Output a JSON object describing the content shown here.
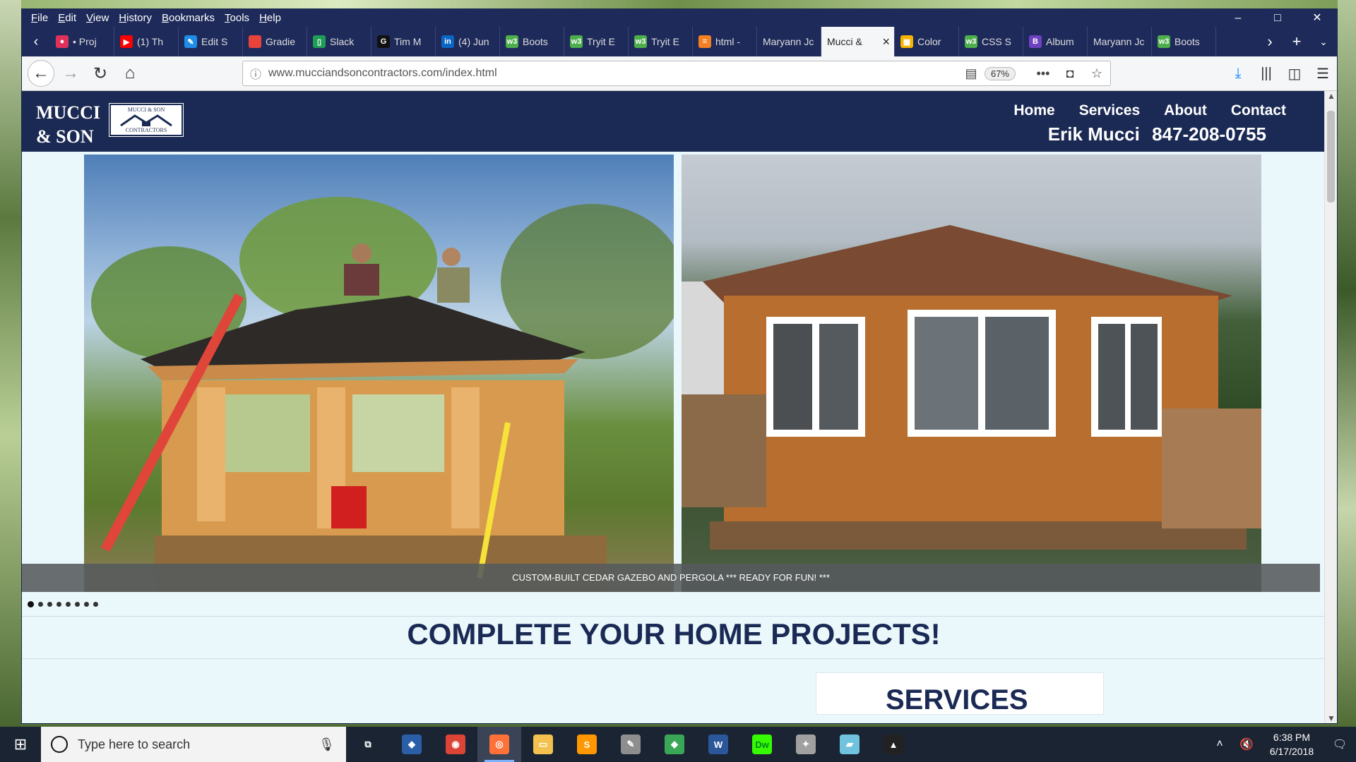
{
  "menu": [
    "File",
    "Edit",
    "View",
    "History",
    "Bookmarks",
    "Tools",
    "Help"
  ],
  "window_controls": {
    "minimize": "–",
    "maximize": "□",
    "close": "✕"
  },
  "tabs": [
    {
      "label": "• Proj",
      "color": "#e0315b",
      "glyph": "●"
    },
    {
      "label": "(1) Th",
      "color": "#ff0000",
      "glyph": "▶"
    },
    {
      "label": "Edit S",
      "color": "#1f8ce8",
      "glyph": "✎"
    },
    {
      "label": "Gradie",
      "color": "#e8433a",
      "glyph": ""
    },
    {
      "label": "Slack",
      "color": "#1f9d55",
      "glyph": "▯"
    },
    {
      "label": "Tim M",
      "color": "#111111",
      "glyph": "G"
    },
    {
      "label": "(4) Jun",
      "color": "#0a66c2",
      "glyph": "in"
    },
    {
      "label": "Boots",
      "color": "#4cae4c",
      "glyph": "w3"
    },
    {
      "label": "Tryit E",
      "color": "#4cae4c",
      "glyph": "w3"
    },
    {
      "label": "Tryit E",
      "color": "#4cae4c",
      "glyph": "w3"
    },
    {
      "label": "html -",
      "color": "#f48024",
      "glyph": "≡"
    },
    {
      "label": "Maryann Jc",
      "color": "",
      "glyph": ""
    },
    {
      "label": "Mucci &",
      "color": "",
      "glyph": "",
      "active": true
    },
    {
      "label": "Color",
      "color": "#f4b400",
      "glyph": "▦"
    },
    {
      "label": "CSS S",
      "color": "#4cae4c",
      "glyph": "w3"
    },
    {
      "label": "Album",
      "color": "#6f42c1",
      "glyph": "B"
    },
    {
      "label": "Maryann Jc",
      "color": "",
      "glyph": ""
    },
    {
      "label": "Boots",
      "color": "#4cae4c",
      "glyph": "w3"
    }
  ],
  "address": {
    "url": "www.mucciandsoncontractors.com/index.html",
    "zoom": "67%"
  },
  "site": {
    "logo_line1": "MUCCI",
    "logo_line2": "& SON",
    "logo_badge_top": "MUCCI & SON",
    "logo_badge_bottom": "CONTRACTORS",
    "nav": [
      "Home",
      "Services",
      "About",
      "Contact"
    ],
    "contact_name": "Erik Mucci",
    "contact_phone": "847-208-0755"
  },
  "carousel": {
    "caption": "CUSTOM-BUILT CEDAR GAZEBO AND PERGOLA *** READY FOR FUN! ***",
    "slide_count": 8,
    "active_slide": 0
  },
  "headline": "COMPLETE YOUR HOME PROJECTS!",
  "services_heading": "SERVICES",
  "taskbar": {
    "search_placeholder": "Type here to search",
    "time": "6:38 PM",
    "date": "6/17/2018",
    "apps": [
      {
        "name": "task-view",
        "color": "#1b2433",
        "glyph": "⧉"
      },
      {
        "name": "app-icon",
        "color": "#2a5fa8",
        "glyph": "◆"
      },
      {
        "name": "chrome",
        "color": "#db4437",
        "glyph": "◉"
      },
      {
        "name": "firefox",
        "color": "#ff7139",
        "glyph": "◎",
        "active": true
      },
      {
        "name": "file-explorer",
        "color": "#f2c14e",
        "glyph": "▭"
      },
      {
        "name": "sublime-text",
        "color": "#ff9800",
        "glyph": "S"
      },
      {
        "name": "paint",
        "color": "#8e8e8e",
        "glyph": "✎"
      },
      {
        "name": "git-app",
        "color": "#3aa757",
        "glyph": "◆"
      },
      {
        "name": "word",
        "color": "#2b579a",
        "glyph": "W"
      },
      {
        "name": "dreamweaver",
        "color": "#35fa00",
        "glyph": "Dw"
      },
      {
        "name": "palette",
        "color": "#a0a0a0",
        "glyph": "✦"
      },
      {
        "name": "notes",
        "color": "#6fc3df",
        "glyph": "▰"
      },
      {
        "name": "photos",
        "color": "#222222",
        "glyph": "▲"
      }
    ]
  }
}
